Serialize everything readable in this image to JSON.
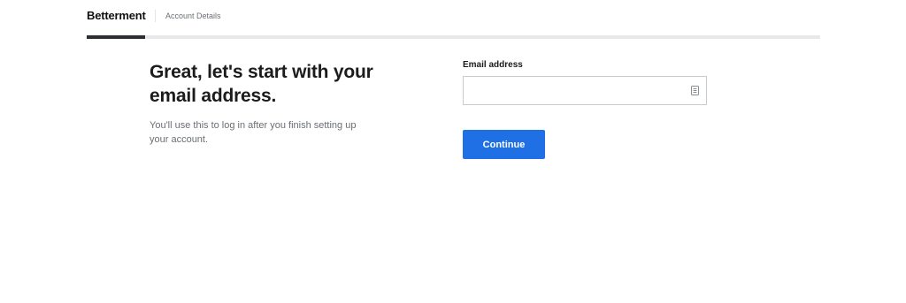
{
  "header": {
    "logo_text": "Betterment",
    "step_label": "Account Details"
  },
  "progress": {
    "fraction": 0.08
  },
  "main": {
    "heading": "Great, let's start with your email address.",
    "subtext": "You'll use this to log in after you finish setting up your account."
  },
  "form": {
    "email_label": "Email address",
    "email_value": "",
    "continue_label": "Continue"
  },
  "icons": {
    "autofill": "contact-card-icon"
  },
  "colors": {
    "accent": "#1f6fe5",
    "progress_fill": "#2b2f33",
    "progress_track": "#e6e8ea"
  }
}
